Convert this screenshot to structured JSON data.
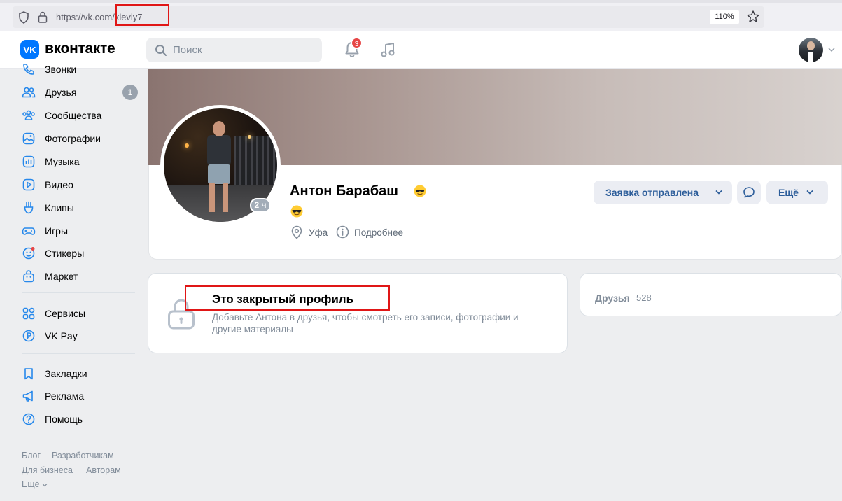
{
  "browser": {
    "url_host": "https://vk.com/",
    "url_path": "kleviy7",
    "zoom": "110%"
  },
  "header": {
    "logo_text": "вконтакте",
    "search_placeholder": "Поиск",
    "notifications_count": "3"
  },
  "sidebar": {
    "items": [
      {
        "label": "Звонки",
        "icon": "phone-icon"
      },
      {
        "label": "Друзья",
        "icon": "friends-icon",
        "badge": "1"
      },
      {
        "label": "Сообщества",
        "icon": "communities-icon"
      },
      {
        "label": "Фотографии",
        "icon": "photos-icon"
      },
      {
        "label": "Музыка",
        "icon": "music-icon"
      },
      {
        "label": "Видео",
        "icon": "video-icon"
      },
      {
        "label": "Клипы",
        "icon": "clips-icon"
      },
      {
        "label": "Игры",
        "icon": "games-icon"
      },
      {
        "label": "Стикеры",
        "icon": "stickers-icon"
      },
      {
        "label": "Маркет",
        "icon": "market-icon"
      },
      {
        "label": "Сервисы",
        "icon": "services-icon"
      },
      {
        "label": "VK Pay",
        "icon": "vkpay-icon"
      },
      {
        "label": "Закладки",
        "icon": "bookmarks-icon"
      },
      {
        "label": "Реклама",
        "icon": "ads-icon"
      },
      {
        "label": "Помощь",
        "icon": "help-icon"
      }
    ],
    "footer": {
      "blog": "Блог",
      "developers": "Разработчикам",
      "business": "Для бизнеса",
      "authors": "Авторам",
      "more": "Ещё"
    }
  },
  "profile": {
    "name": "Антон Барабаш",
    "online_status": "2 ч",
    "city": "Уфа",
    "details_link": "Подробнее",
    "request_button": "Заявка отправлена",
    "more_button": "Ещё"
  },
  "closed_profile": {
    "title": "Это закрытый профиль",
    "description": "Добавьте Антона в друзья, чтобы смотреть его записи, фотографии и другие материалы"
  },
  "friends": {
    "label": "Друзья",
    "count": "528"
  },
  "colors": {
    "vk_blue": "#0077ff",
    "annotation_red": "#e01616",
    "button_text": "#2c5d9a"
  }
}
